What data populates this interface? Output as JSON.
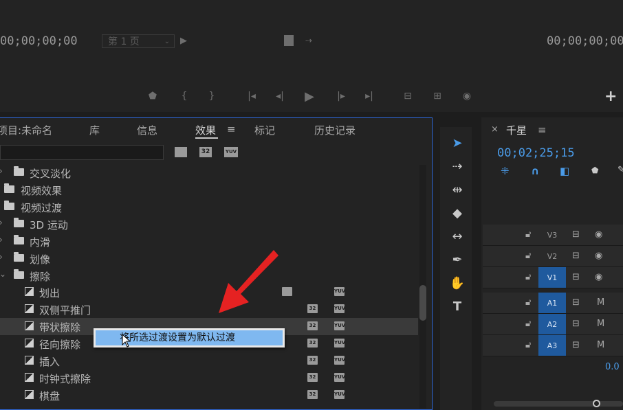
{
  "monitor": {
    "left_timecode": "00;00;00;00",
    "page_select": "第 1 页",
    "right_timecode": "00;00;00;00",
    "add_label": "+"
  },
  "panel": {
    "tabs": [
      {
        "label": "项目:未命名"
      },
      {
        "label": "库"
      },
      {
        "label": "信息"
      },
      {
        "label": "效果",
        "active": true
      },
      {
        "label": "标记"
      },
      {
        "label": "历史记录"
      }
    ],
    "menu_icon": "≡",
    "filter_badges": [
      "32",
      "YUV"
    ]
  },
  "tree": [
    {
      "label": "交叉淡化",
      "type": "folder",
      "expanded": false
    },
    {
      "label": "视频效果",
      "type": "folder",
      "expanded": false
    },
    {
      "label": "视频过渡",
      "type": "folder",
      "expanded": true
    },
    {
      "label": "3D 运动",
      "type": "folder",
      "expanded": false
    },
    {
      "label": "内滑",
      "type": "folder",
      "expanded": false
    },
    {
      "label": "划像",
      "type": "folder",
      "expanded": false
    },
    {
      "label": "擦除",
      "type": "folder",
      "expanded": true
    },
    {
      "label": "划出",
      "type": "effect"
    },
    {
      "label": "双侧平推门",
      "type": "effect"
    },
    {
      "label": "带状擦除",
      "type": "effect",
      "selected": true
    },
    {
      "label": "径向擦除",
      "type": "effect"
    },
    {
      "label": "插入",
      "type": "effect"
    },
    {
      "label": "时钟式擦除",
      "type": "effect"
    },
    {
      "label": "棋盘",
      "type": "effect"
    }
  ],
  "context_menu": {
    "item": "将所选过渡设置为默认过渡"
  },
  "timeline": {
    "title": "千星",
    "close": "×",
    "menu_icon": "≡",
    "timecode": "00;02;25;15",
    "tracks": [
      {
        "label": "V3",
        "on": false,
        "right": "eye"
      },
      {
        "label": "V2",
        "on": false,
        "right": "eye"
      },
      {
        "label": "V1",
        "on": true,
        "right": "eye"
      },
      {
        "label": "A1",
        "on": true,
        "right": "M"
      },
      {
        "label": "A2",
        "on": true,
        "right": "M"
      },
      {
        "label": "A3",
        "on": true,
        "right": "M"
      }
    ],
    "master_value": "0.0"
  },
  "colors": {
    "accent": "#2e67d8",
    "track_on": "#1f5a9e",
    "timecode": "#4a9be8",
    "menu_highlight": "#7fb8f0"
  }
}
